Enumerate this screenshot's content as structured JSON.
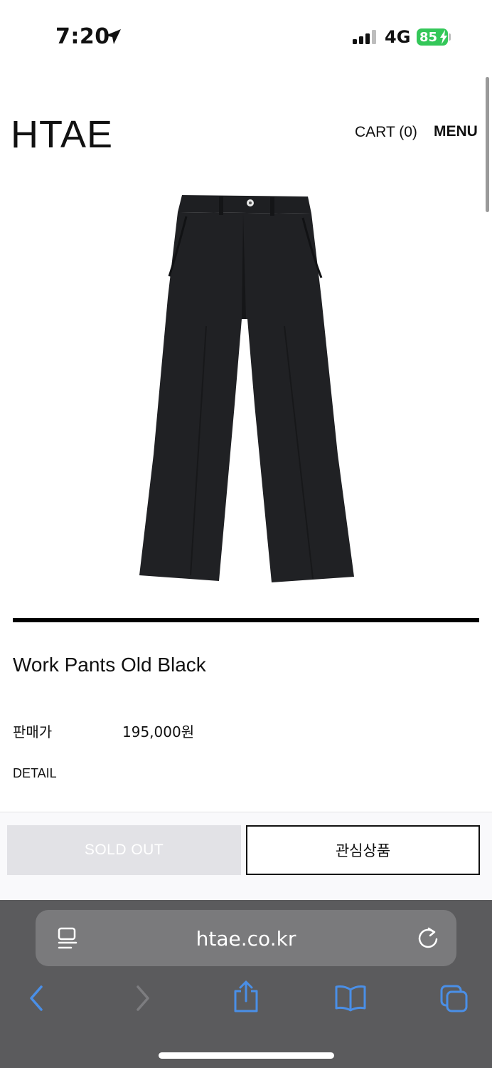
{
  "status_bar": {
    "time": "7:20",
    "network": "4G",
    "battery": "85"
  },
  "header": {
    "logo": "HTAE",
    "cart": "CART (0)",
    "menu": "MENU"
  },
  "product": {
    "image_alt": "Black work pants",
    "name": "Work Pants Old Black",
    "price_label": "판매가",
    "price": "195,000원",
    "detail_label": "DETAIL"
  },
  "actions": {
    "sold_out": "SOLD OUT",
    "wishlist": "관심상품"
  },
  "browser": {
    "url": "htae.co.kr"
  },
  "colors": {
    "battery": "#34c759",
    "browser_chrome": "#5b5b5d",
    "url_bar": "#7a7a7c",
    "toolbar_icon": "#4a8fe7"
  }
}
